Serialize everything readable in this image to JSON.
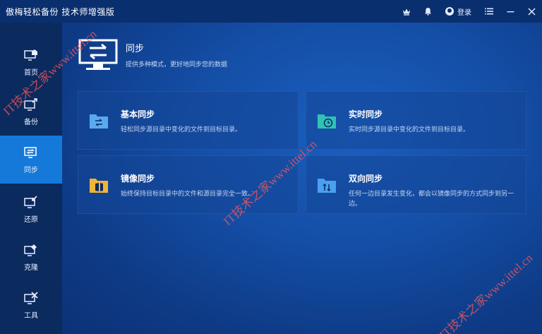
{
  "window": {
    "title": "傲梅轻松备份 技术师增强版",
    "login_label": "登录"
  },
  "sidebar": {
    "items": [
      {
        "label": "首页",
        "icon": "home-icon"
      },
      {
        "label": "备份",
        "icon": "backup-icon"
      },
      {
        "label": "同步",
        "icon": "sync-icon",
        "active": true
      },
      {
        "label": "还原",
        "icon": "restore-icon"
      },
      {
        "label": "克隆",
        "icon": "clone-icon"
      },
      {
        "label": "工具",
        "icon": "tools-icon"
      }
    ]
  },
  "main": {
    "title": "同步",
    "subtitle": "提供多种模式，更好地同步您的数据",
    "cards": [
      {
        "title": "基本同步",
        "desc": "轻松同步源目录中变化的文件到目标目录。",
        "icon": "folder-sync-icon",
        "color": "#5aa9f0"
      },
      {
        "title": "实时同步",
        "desc": "实时同步源目录中变化的文件到目标目录。",
        "icon": "folder-clock-icon",
        "color": "#2fc2b6"
      },
      {
        "title": "镜像同步",
        "desc": "始终保持目标目录中的文件和源目录完全一致。",
        "icon": "folder-mirror-icon",
        "color": "#f0b43a"
      },
      {
        "title": "双向同步",
        "desc": "任何一边目录发生变化，都会以镜像同步的方式同步到另一边。",
        "icon": "folder-twoway-icon",
        "color": "#4aa0ee"
      }
    ]
  },
  "watermarks": [
    "IT技术之家www.ittel.cn",
    "IT技术之家www.ittel.cn",
    "IT技术之家www.ittel.cn"
  ],
  "colors": {
    "active_nav": "#1479d9",
    "sidebar": "#0b2a5e",
    "titlebar": "#0a2f6e"
  }
}
